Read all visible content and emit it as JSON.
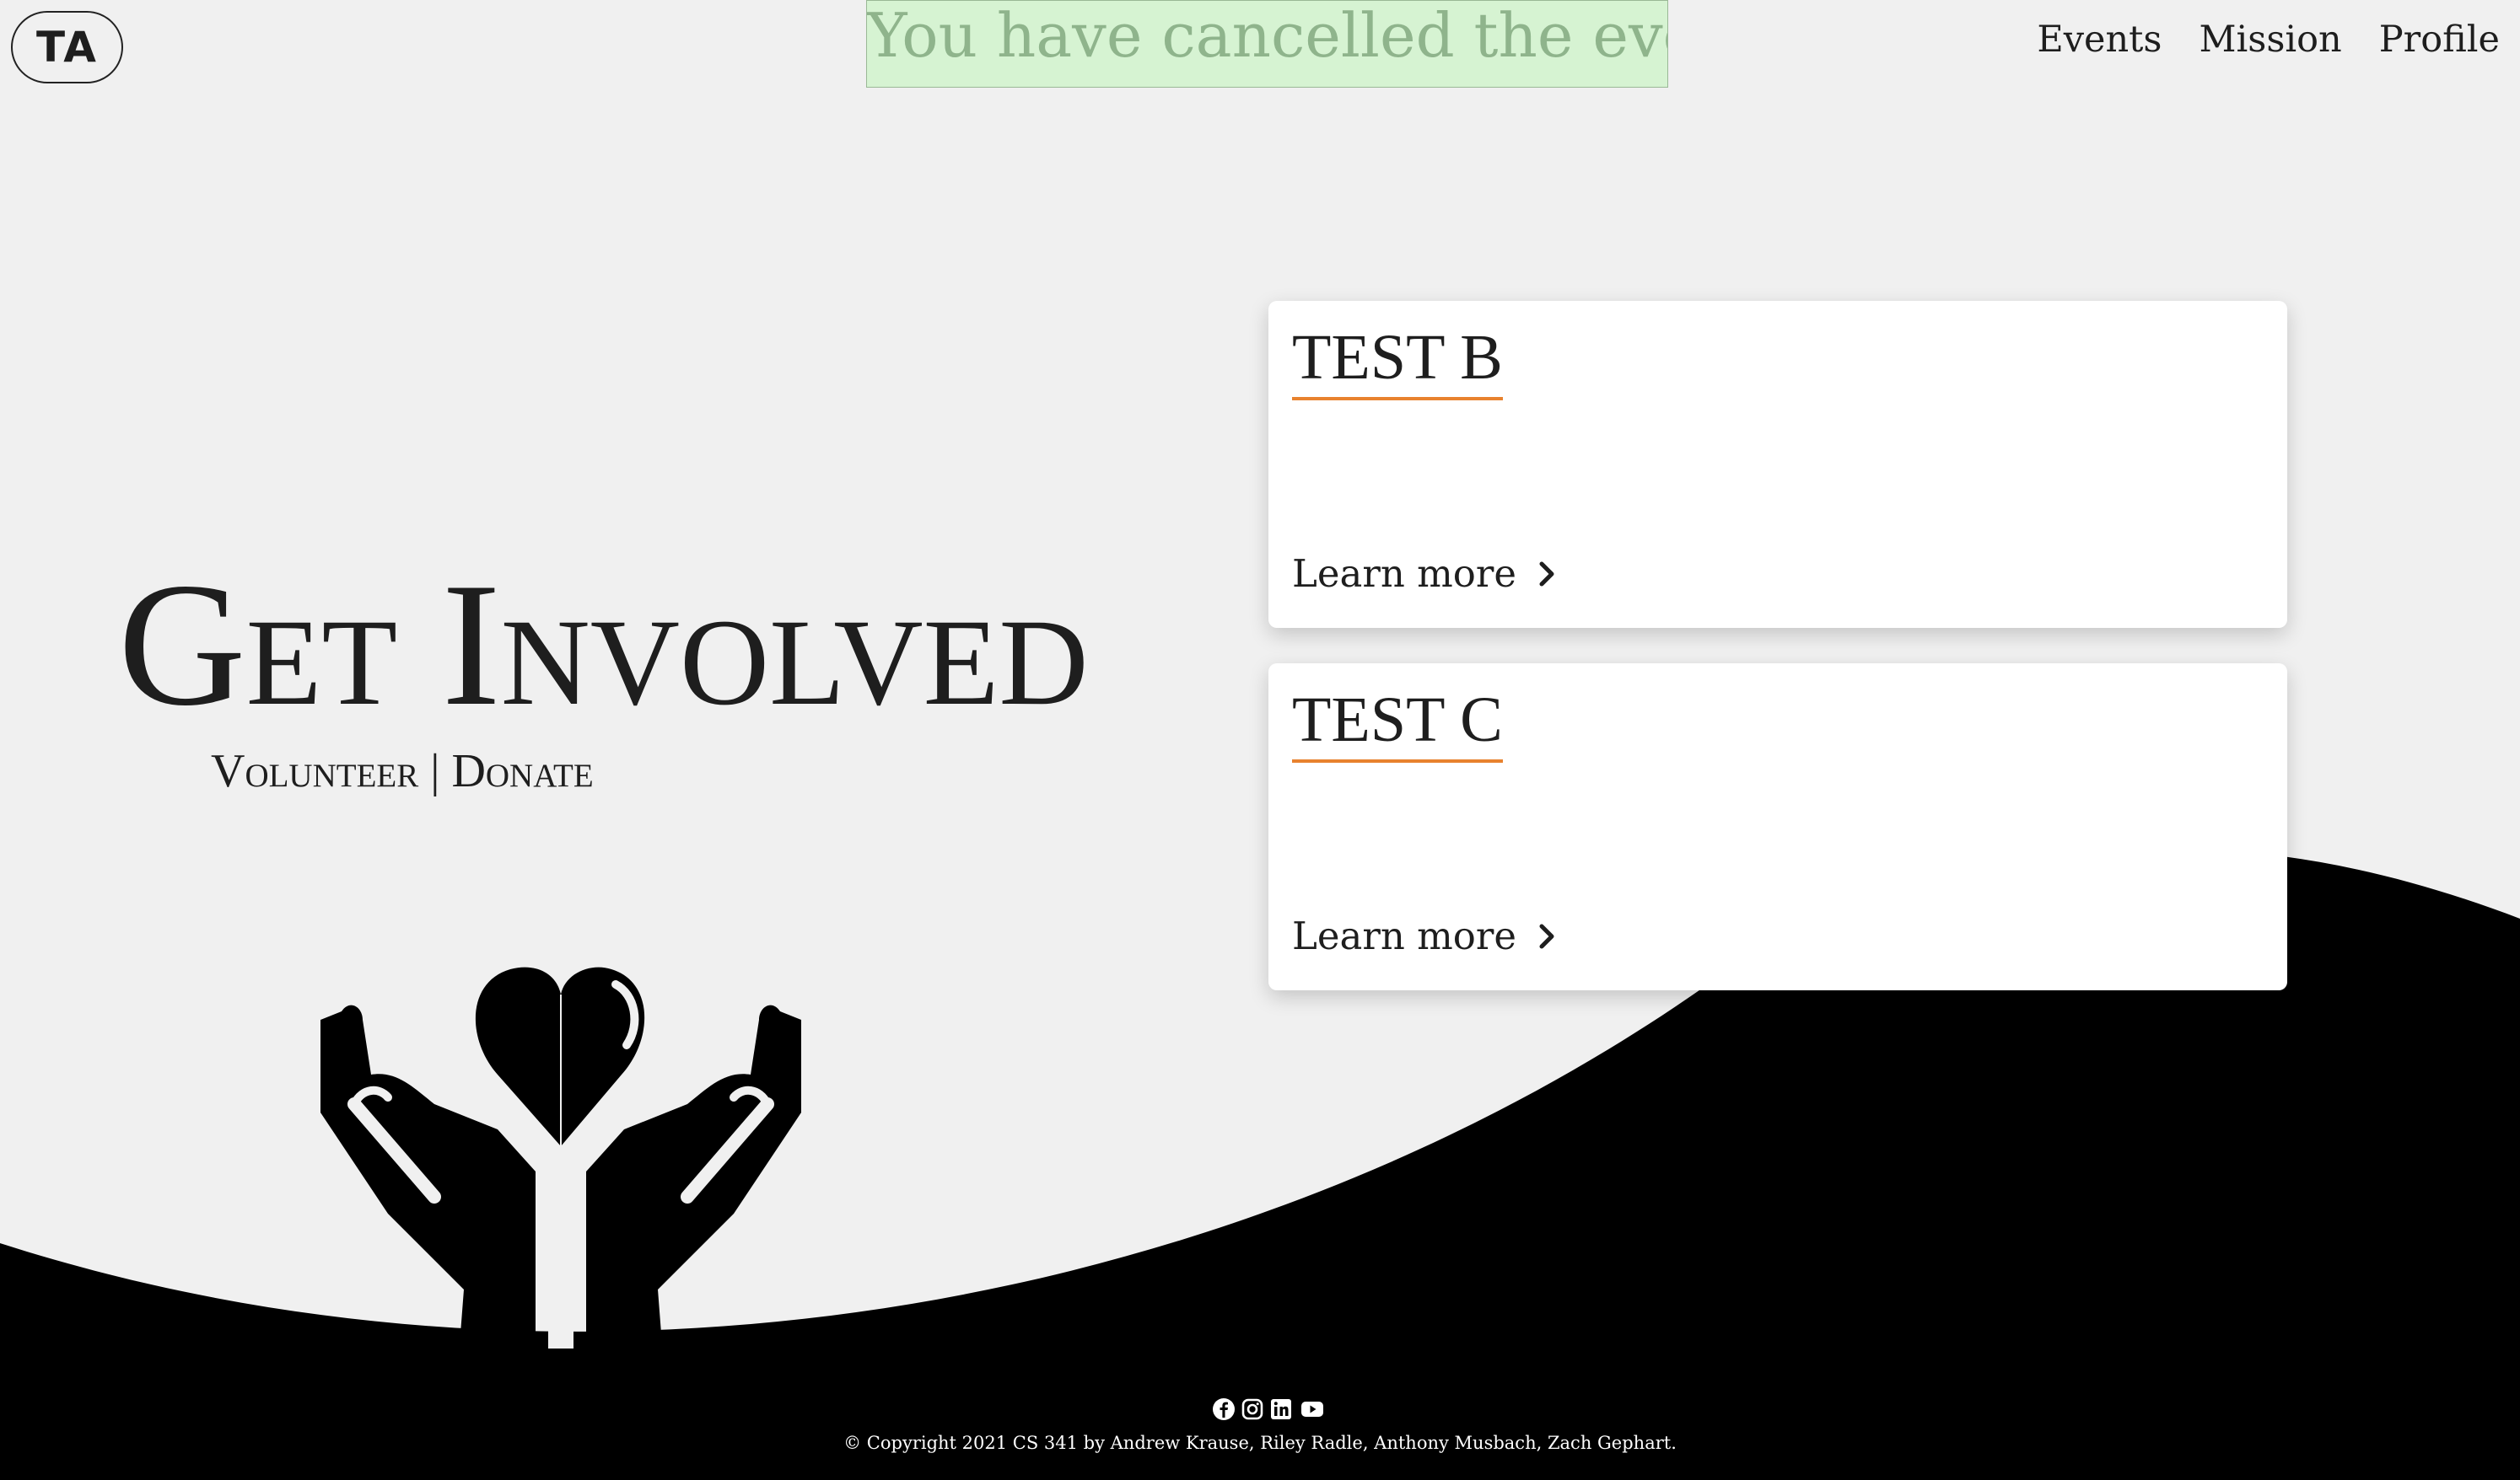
{
  "logo": {
    "text": "TA"
  },
  "alert": {
    "message": "You have cancelled the event."
  },
  "nav": {
    "items": [
      "Events",
      "Mission",
      "Profile"
    ]
  },
  "hero": {
    "title": "Get Involved",
    "subtitle": "Volunteer | Donate"
  },
  "cards": [
    {
      "title": "TEST B",
      "link_label": "Learn more"
    },
    {
      "title": "TEST C",
      "link_label": "Learn more"
    }
  ],
  "footer": {
    "social_icons": [
      "facebook-icon",
      "instagram-icon",
      "linkedin-icon",
      "youtube-icon"
    ],
    "copyright": "© Copyright 2021 CS 341 by Andrew Krause, Riley Radle, Anthony Musbach, Zach Gephart."
  },
  "colors": {
    "background": "#f0f0f0",
    "wave": "#000000",
    "alert_bg": "#d6f3d2",
    "alert_text": "#8fb48c",
    "accent_underline": "#e8822e"
  }
}
